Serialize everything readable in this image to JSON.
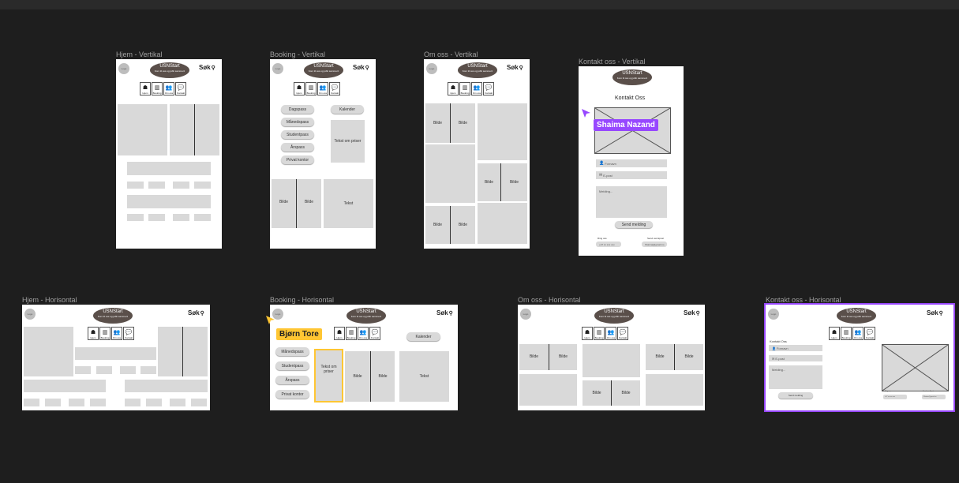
{
  "frames": {
    "hjem_v": "Hjem - Vertikal",
    "booking_v": "Booking - Vertikal",
    "omoss_v": "Om oss - Vertikal",
    "kontakt_v": "Kontakt oss - Vertikal",
    "hjem_h": "Hjem - Horisontal",
    "booking_h": "Booking - Horisontal",
    "omoss_h": "Om oss - Horisontal",
    "kontakt_h": "Kontakt oss - Horisontal"
  },
  "common": {
    "logo": "Logo",
    "brand_title": "USNStart",
    "brand_sub": "Kom til oss og jobb sammen!",
    "search": "Søk",
    "search_icon": "⚲"
  },
  "nav": [
    {
      "label": "Hjem",
      "icon": "☗"
    },
    {
      "label": "Booking",
      "icon": "▥"
    },
    {
      "label": "Om oss",
      "icon": "👥"
    },
    {
      "label": "Kontakt",
      "icon": "💬"
    }
  ],
  "booking": {
    "dagpass": "Dagspass",
    "maanedspass": "Månedspass",
    "studentpass": "Studentpass",
    "aarspass": "Årspass",
    "privat": "Privat kontor",
    "kalender": "Kalender",
    "tekst_priser": "Tekst om priser",
    "bilde": "Bilde",
    "tekst": "Tekst"
  },
  "contact": {
    "title": "Kontakt Oss",
    "title_h": "Kontakt Oss",
    "name_ph": "Fornavn",
    "email_ph": "E-post",
    "message_ph": "Melding...",
    "send": "Send melding",
    "ring_label": "Ring oss",
    "ring_value": "+47 xx xxx xxx",
    "mail_label": "Send oss Epost",
    "mail_value": "Shaima@gmail.no"
  },
  "collaborators": {
    "shaima": "Shaima Nazand",
    "bjorn": "Bjørn Tore",
    "shaima_color": "#9747ff",
    "bjorn_color": "#ffc633"
  },
  "colors": {
    "canvas": "#1e1e1e",
    "placeholder": "#d9d9d9",
    "brand": "#5a4f4a",
    "selection": "#9747ff"
  }
}
